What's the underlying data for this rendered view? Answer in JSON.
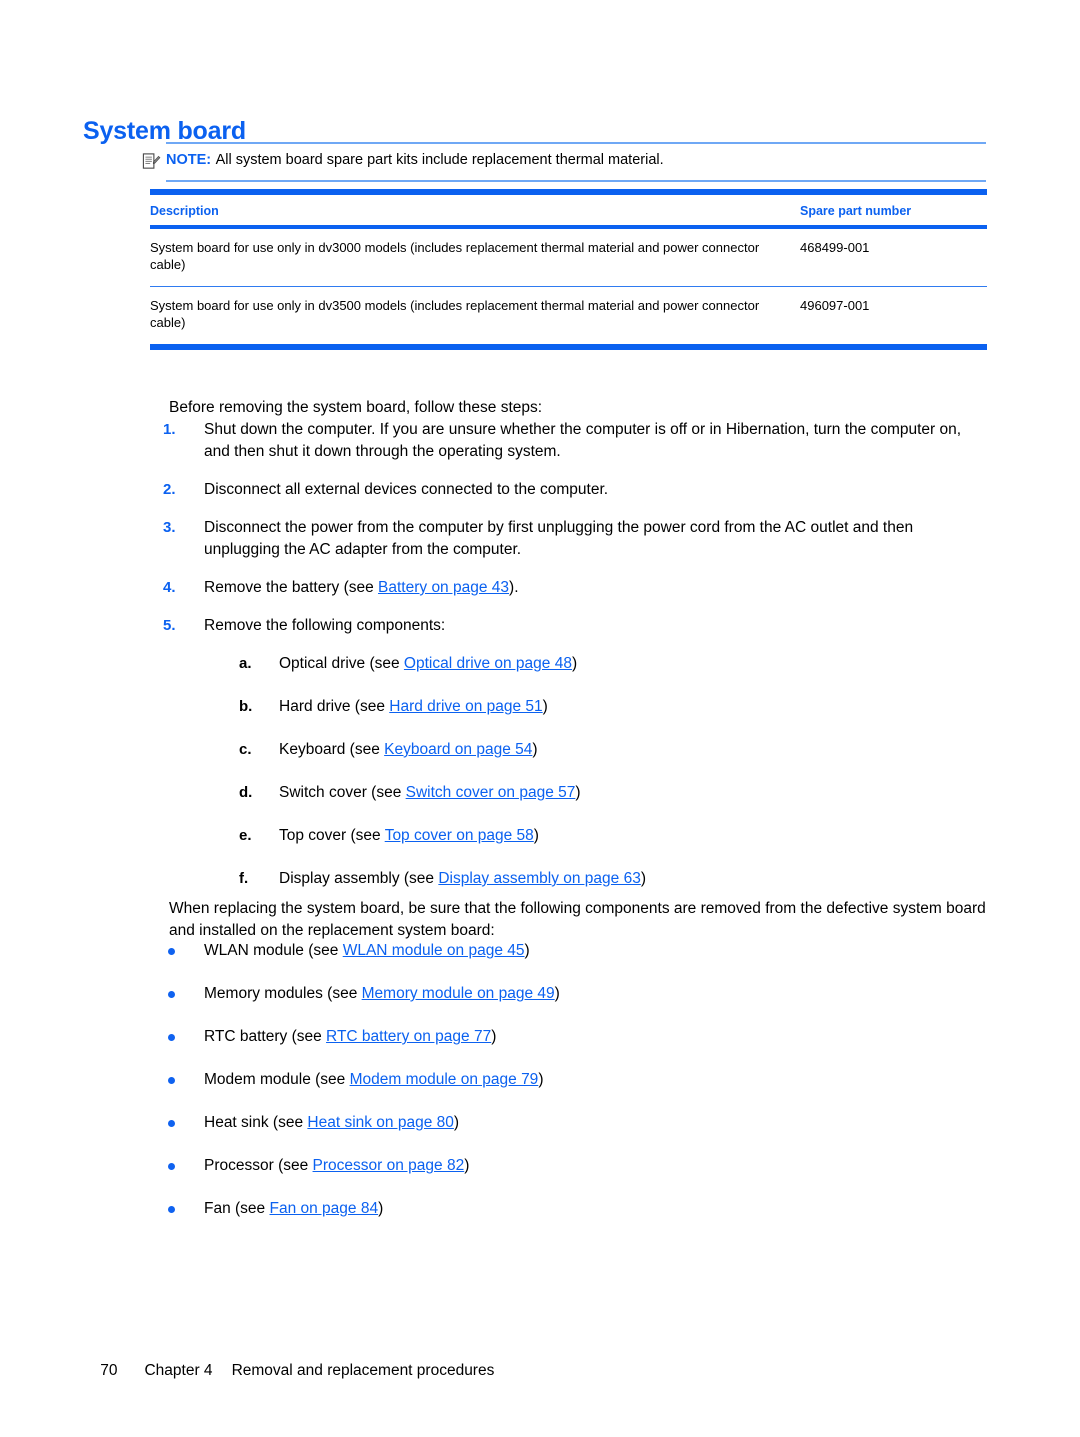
{
  "heading": "System board",
  "note": {
    "icon": "note-pencil-icon",
    "label": "NOTE:",
    "text": "All system board spare part kits include replacement thermal material."
  },
  "table": {
    "columns": [
      "Description",
      "Spare part number"
    ],
    "rows": [
      {
        "description": "System board for use only in dv3000 models (includes replacement thermal material and power connector cable)",
        "spare_part_number": "468499-001"
      },
      {
        "description": "System board for use only in dv3500 models (includes replacement thermal material and power connector cable)",
        "spare_part_number": "496097-001"
      }
    ]
  },
  "intro": "Before removing the system board, follow these steps:",
  "steps": [
    {
      "marker": "1.",
      "text": "Shut down the computer. If you are unsure whether the computer is off or in Hibernation, turn the computer on, and then shut it down through the operating system."
    },
    {
      "marker": "2.",
      "text": "Disconnect all external devices connected to the computer."
    },
    {
      "marker": "3.",
      "text": "Disconnect the power from the computer by first unplugging the power cord from the AC outlet and then unplugging the AC adapter from the computer."
    },
    {
      "marker": "4.",
      "pre": "Remove the battery (see ",
      "link": "Battery on page 43",
      "post": ")."
    },
    {
      "marker": "5.",
      "text": "Remove the following components:"
    }
  ],
  "substeps": [
    {
      "marker": "a.",
      "pre": "Optical drive (see ",
      "link": "Optical drive on page 48",
      "post": ")"
    },
    {
      "marker": "b.",
      "pre": "Hard drive (see ",
      "link": "Hard drive on page 51",
      "post": ")"
    },
    {
      "marker": "c.",
      "pre": "Keyboard (see ",
      "link": "Keyboard on page 54",
      "post": ")"
    },
    {
      "marker": "d.",
      "pre": "Switch cover (see ",
      "link": "Switch cover on page 57",
      "post": ")"
    },
    {
      "marker": "e.",
      "pre": "Top cover (see ",
      "link": "Top cover on page 58",
      "post": ")"
    },
    {
      "marker": "f.",
      "pre": "Display assembly (see ",
      "link": "Display assembly on page 63",
      "post": ")"
    }
  ],
  "replace_note": "When replacing the system board, be sure that the following components are removed from the defective system board and installed on the replacement system board:",
  "bullets": [
    {
      "pre": "WLAN module (see ",
      "link": "WLAN module on page 45",
      "post": ")"
    },
    {
      "pre": "Memory modules (see ",
      "link": "Memory module on page 49",
      "post": ")"
    },
    {
      "pre": "RTC battery (see ",
      "link": "RTC battery on page 77",
      "post": ")"
    },
    {
      "pre": "Modem module (see ",
      "link": "Modem module on page 79",
      "post": ")"
    },
    {
      "pre": "Heat sink (see ",
      "link": "Heat sink on page 80",
      "post": ")"
    },
    {
      "pre": "Processor (see ",
      "link": "Processor on page 82",
      "post": ")"
    },
    {
      "pre": "Fan (see ",
      "link": "Fan on page 84",
      "post": ")"
    }
  ],
  "footer": {
    "page_number": "70",
    "chapter": "Chapter 4",
    "chapter_title": "Removal and replacement procedures"
  },
  "colors": {
    "accent_blue": "#0b61f0",
    "rule_blue": "#6fa8f5",
    "text_black": "#000000"
  }
}
